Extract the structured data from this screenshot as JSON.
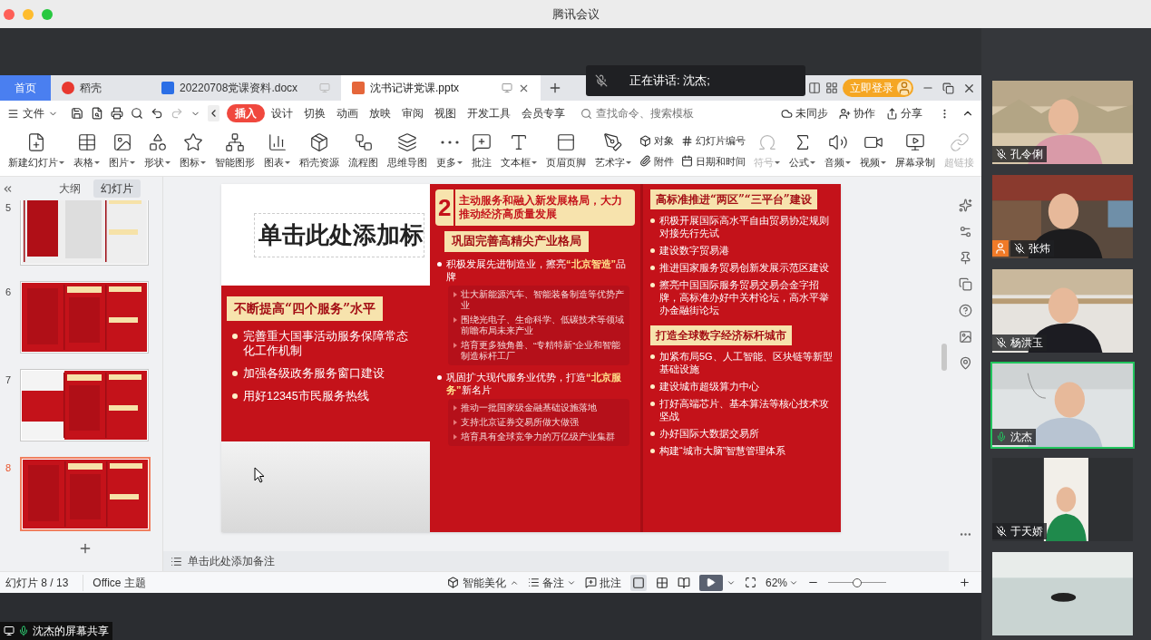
{
  "window": {
    "title": "腾讯会议"
  },
  "speaking_banner": {
    "text": "正在讲话: 沈杰;"
  },
  "app_tabs": [
    {
      "label": "首页",
      "kind": "home",
      "selected": false
    },
    {
      "label": "稻壳",
      "kind": "docer",
      "selected": false
    },
    {
      "label": "20220708党课资料.docx",
      "kind": "doc",
      "selected": false
    },
    {
      "label": "沈书记讲党课.pptx",
      "kind": "ppt",
      "selected": true
    }
  ],
  "login_button": "立即登录",
  "file_menu": "文件",
  "ribbon_tabs": [
    {
      "label": "插入",
      "selected": true
    },
    {
      "label": "设计",
      "selected": false
    },
    {
      "label": "切换",
      "selected": false
    },
    {
      "label": "动画",
      "selected": false
    },
    {
      "label": "放映",
      "selected": false
    },
    {
      "label": "审阅",
      "selected": false
    },
    {
      "label": "视图",
      "selected": false
    },
    {
      "label": "开发工具",
      "selected": false
    },
    {
      "label": "会员专享",
      "selected": false
    }
  ],
  "search": {
    "placeholder": "查找命令、搜索模板"
  },
  "right_actions": [
    "未同步",
    "协作",
    "分享"
  ],
  "ribbon_tools": [
    {
      "kind": "large",
      "label": "新建幻灯片",
      "dropdown": true,
      "disabled": false
    },
    {
      "kind": "large",
      "label": "表格",
      "dropdown": true,
      "disabled": false
    },
    {
      "kind": "large",
      "label": "图片",
      "dropdown": true,
      "disabled": false
    },
    {
      "kind": "large",
      "label": "形状",
      "dropdown": true,
      "disabled": false
    },
    {
      "kind": "large",
      "label": "图标",
      "dropdown": true,
      "disabled": false
    },
    {
      "kind": "large",
      "label": "智能图形",
      "dropdown": false,
      "disabled": false
    },
    {
      "kind": "large",
      "label": "图表",
      "dropdown": true,
      "disabled": false
    },
    {
      "kind": "large",
      "label": "稻壳资源",
      "dropdown": false,
      "disabled": false
    },
    {
      "kind": "large",
      "label": "流程图",
      "dropdown": false,
      "disabled": false
    },
    {
      "kind": "large",
      "label": "思维导图",
      "dropdown": false,
      "disabled": false
    },
    {
      "kind": "large",
      "label": "更多",
      "dropdown": true,
      "disabled": false
    },
    {
      "kind": "large",
      "label": "批注",
      "dropdown": false,
      "disabled": false
    },
    {
      "kind": "large",
      "label": "文本框",
      "dropdown": true,
      "disabled": false
    },
    {
      "kind": "large",
      "label": "页眉页脚",
      "dropdown": false,
      "disabled": false
    },
    {
      "kind": "large",
      "label": "艺术字",
      "dropdown": true,
      "disabled": false
    },
    {
      "kind": "pair",
      "items": [
        "对象",
        "附件"
      ]
    },
    {
      "kind": "pair",
      "items": [
        "幻灯片编号",
        "日期和时间"
      ]
    },
    {
      "kind": "large",
      "label": "符号",
      "dropdown": true,
      "disabled": true
    },
    {
      "kind": "large",
      "label": "公式",
      "dropdown": true,
      "disabled": false
    },
    {
      "kind": "large",
      "label": "音频",
      "dropdown": true,
      "disabled": false
    },
    {
      "kind": "large",
      "label": "视频",
      "dropdown": true,
      "disabled": false
    },
    {
      "kind": "large",
      "label": "屏幕录制",
      "dropdown": false,
      "disabled": false
    },
    {
      "kind": "large",
      "label": "超链接",
      "dropdown": false,
      "disabled": true
    }
  ],
  "panel_tabs": [
    {
      "label": "大纲",
      "selected": false
    },
    {
      "label": "幻灯片",
      "selected": true
    }
  ],
  "thumbnails": [
    {
      "number": "5",
      "selected": false
    },
    {
      "number": "6",
      "selected": false
    },
    {
      "number": "7",
      "selected": false
    },
    {
      "number": "8",
      "selected": true
    }
  ],
  "slide": {
    "title": "单击此处添加标",
    "left_section": {
      "heading": "不断提高“四个服务”水平",
      "bullets": [
        "完善重大国事活动服务保障常态化工作机制",
        "加强各级政务服务窗口建设",
        "用好12345市民服务热线"
      ]
    },
    "middle_section": {
      "number": "2",
      "heading": "主动服务和融入新发展格局，大力推动经济高质量发展",
      "subheading": "巩固完善高精尖产业格局",
      "groups": [
        {
          "text": "积极发展先进制造业，擦亮**“北京智造”**品牌",
          "items": [
            "壮大新能源汽车、智能装备制造等优势产业",
            "围绕光电子、生命科学、低碳技术等领域前瞻布局未来产业",
            "培育更多独角兽、“专精特新”企业和智能制造标杆工厂"
          ]
        },
        {
          "text": "巩固扩大现代服务业优势，打造**“北京服务”**新名片",
          "items": [
            "推动一批国家级金融基础设施落地",
            "支持北京证券交易所做大做强",
            "培育具有全球竞争力的万亿级产业集群"
          ]
        }
      ]
    },
    "right_sections": [
      {
        "heading": "高标准推进“两区”“三平台”建设",
        "bullets": [
          "积极开展国际高水平自由贸易协定规则对接先行先试",
          "建设数字贸易港",
          "推进国家服务贸易创新发展示范区建设",
          "擦亮中国国际服务贸易交易会金字招牌，高标准办好中关村论坛，高水平举办金融街论坛"
        ]
      },
      {
        "heading": "打造全球数字经济标杆城市",
        "bullets": [
          "加紧布局5G、人工智能、区块链等新型基础设施",
          "建设城市超级算力中心",
          "打好高端芯片、基本算法等核心技术攻坚战",
          "办好国际大数据交易所",
          "构建“城市大脑”智慧管理体系"
        ]
      }
    ]
  },
  "notes_placeholder": "单击此处添加备注",
  "status_bar": {
    "slide_info": "幻灯片 8 / 13",
    "theme": "Office 主题",
    "beautify": "智能美化",
    "notes": "备注",
    "comments": "批注",
    "zoom": "62%"
  },
  "zoom_slider": {
    "level": 0.5
  },
  "participants": [
    {
      "name": "孔令俐",
      "muted": true,
      "speaking": false,
      "avatar_badge": false
    },
    {
      "name": "张炜",
      "muted": true,
      "speaking": false,
      "avatar_badge": true
    },
    {
      "name": "杨洪玉",
      "muted": true,
      "speaking": false,
      "avatar_badge": false
    },
    {
      "name": "沈杰",
      "muted": false,
      "speaking": true,
      "avatar_badge": false
    },
    {
      "name": "于天娇",
      "muted": true,
      "speaking": false,
      "avatar_badge": false
    },
    {
      "speaking": false
    }
  ],
  "share_label": "沈杰的屏幕共享"
}
